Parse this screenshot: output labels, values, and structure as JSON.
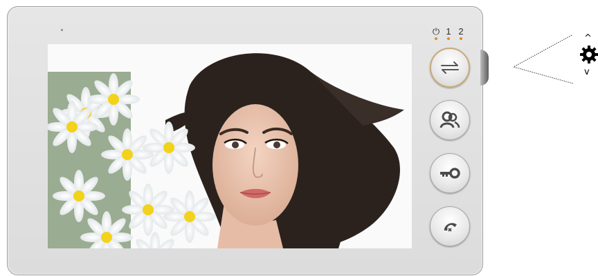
{
  "indicators": {
    "power_symbol": "⏻",
    "channel_1": "1",
    "channel_2": "2",
    "led_color": "#e58a1f"
  },
  "buttons": [
    {
      "name": "switch-channel",
      "icon": "swap-arrows-icon"
    },
    {
      "name": "contacts",
      "icon": "users-icon"
    },
    {
      "name": "unlock",
      "icon": "key-icon"
    },
    {
      "name": "hang-up",
      "icon": "phone-hangup-icon"
    }
  ],
  "screen": {
    "content": "video-feed-image"
  },
  "settings": {
    "icon": "gear-icon",
    "up_arrow": "^",
    "down_arrow": "v"
  },
  "colors": {
    "device_body": "#e0e0e0",
    "button_ring_accent": "#c8aa7a",
    "icon_color": "#4a4a4a"
  }
}
